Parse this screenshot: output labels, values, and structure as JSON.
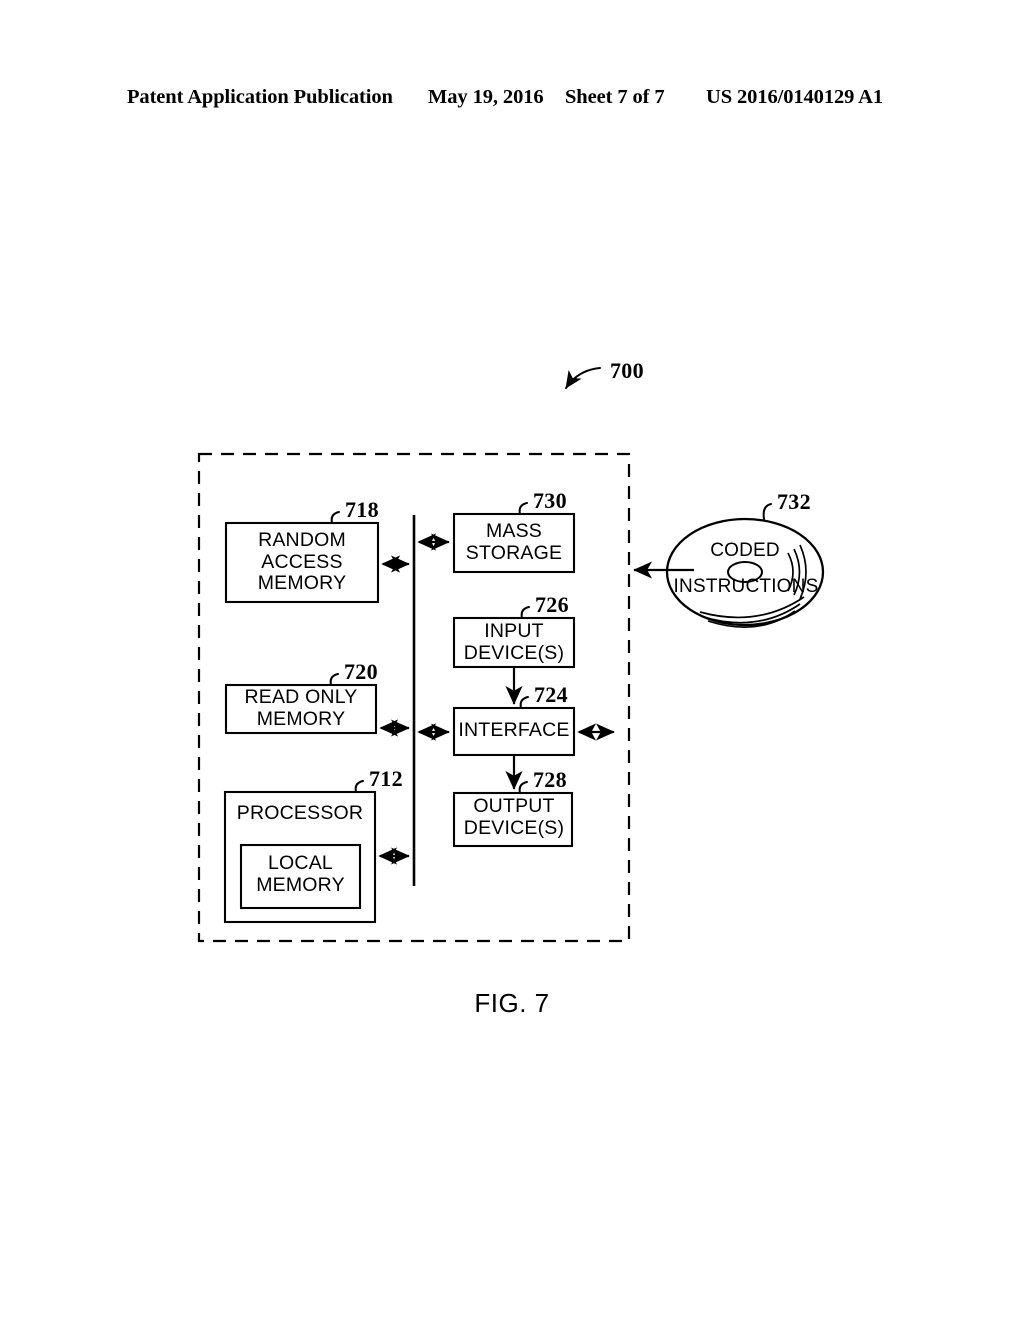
{
  "header": {
    "publication": "Patent Application Publication",
    "date": "May 19, 2016",
    "sheet": "Sheet 7 of 7",
    "patent_number": "US 2016/0140129 A1"
  },
  "figure": {
    "caption": "FIG. 7",
    "system_ref": "700",
    "blocks": [
      {
        "id": "ram",
        "label": "RANDOM\nACCESS\nMEMORY",
        "ref": "718"
      },
      {
        "id": "rom",
        "label": "READ ONLY\nMEMORY",
        "ref": "720"
      },
      {
        "id": "processor",
        "label": "PROCESSOR",
        "ref": "712"
      },
      {
        "id": "local-memory",
        "label": "LOCAL\nMEMORY",
        "ref": ""
      },
      {
        "id": "mass-storage",
        "label": "MASS\nSTORAGE",
        "ref": "730"
      },
      {
        "id": "input-devices",
        "label": "INPUT\nDEVICE(S)",
        "ref": "726"
      },
      {
        "id": "interface",
        "label": "INTERFACE",
        "ref": "724"
      },
      {
        "id": "output-devices",
        "label": "OUTPUT\nDEVICE(S)",
        "ref": "728"
      }
    ],
    "disc": {
      "ref": "732",
      "line1": "CODED",
      "line2": "INSTRUCTIONS"
    }
  },
  "chart_data": {
    "type": "diagram",
    "title": "FIG. 7 — Example processor platform 700",
    "nodes": [
      {
        "ref": "700",
        "label": "Processor platform (dashed enclosure)"
      },
      {
        "ref": "718",
        "label": "RANDOM ACCESS MEMORY"
      },
      {
        "ref": "720",
        "label": "READ ONLY MEMORY"
      },
      {
        "ref": "712",
        "label": "PROCESSOR"
      },
      {
        "ref": "",
        "label": "LOCAL MEMORY"
      },
      {
        "ref": "730",
        "label": "MASS STORAGE"
      },
      {
        "ref": "726",
        "label": "INPUT DEVICE(S)"
      },
      {
        "ref": "724",
        "label": "INTERFACE"
      },
      {
        "ref": "728",
        "label": "OUTPUT DEVICE(S)"
      },
      {
        "ref": "732",
        "label": "CODED INSTRUCTIONS"
      }
    ],
    "edges": [
      {
        "from": "718",
        "to": "bus",
        "arrow": "double"
      },
      {
        "from": "720",
        "to": "bus",
        "arrow": "double"
      },
      {
        "from": "712",
        "to": "bus",
        "arrow": "double"
      },
      {
        "from": "bus",
        "to": "730",
        "arrow": "double"
      },
      {
        "from": "bus",
        "to": "724",
        "arrow": "double"
      },
      {
        "from": "726",
        "to": "724",
        "arrow": "single"
      },
      {
        "from": "724",
        "to": "728",
        "arrow": "single"
      },
      {
        "from": "724",
        "to": "external",
        "arrow": "double"
      },
      {
        "from": "732",
        "to": "700",
        "arrow": "single"
      }
    ]
  }
}
